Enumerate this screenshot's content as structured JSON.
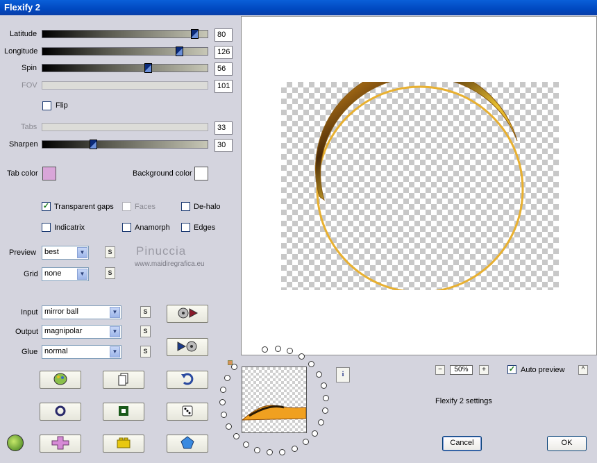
{
  "window": {
    "title": "Flexify 2"
  },
  "sliders": [
    {
      "label": "Latitude",
      "value": "80",
      "level": 0.94,
      "enabled": true
    },
    {
      "label": "Longitude",
      "value": "126",
      "level": 0.83,
      "enabled": true
    },
    {
      "label": "Spin",
      "value": "56",
      "level": 0.64,
      "enabled": true
    },
    {
      "label": "FOV",
      "value": "101",
      "enabled": false
    },
    {
      "label": "Tabs",
      "value": "33",
      "enabled": false
    },
    {
      "label": "Sharpen",
      "value": "30",
      "level": 0.31,
      "enabled": true
    }
  ],
  "flip": {
    "label": "Flip",
    "checked": false
  },
  "colors": {
    "tab_label": "Tab color",
    "tab_color": "#d9a6d9",
    "bg_label": "Background color",
    "bg_color": "#ffffff"
  },
  "options": {
    "transparent_gaps": {
      "label": "Transparent gaps",
      "checked": true
    },
    "faces": {
      "label": "Faces",
      "checked": false
    },
    "dehalo": {
      "label": "De-halo",
      "checked": false
    },
    "indicatrix": {
      "label": "Indicatrix",
      "checked": false
    },
    "anamorph": {
      "label": "Anamorph",
      "checked": false
    },
    "edges": {
      "label": "Edges",
      "checked": false
    }
  },
  "preview_select": {
    "label": "Preview",
    "value": "best"
  },
  "grid_select": {
    "label": "Grid",
    "value": "none"
  },
  "input_select": {
    "label": "Input",
    "value": "mirror ball"
  },
  "output_select": {
    "label": "Output",
    "value": "magnipolar"
  },
  "glue_select": {
    "label": "Glue",
    "value": "normal"
  },
  "s_label": "S",
  "watermark": {
    "name": "Pinuccia",
    "url": "www.maidiregrafica.eu"
  },
  "zoom": {
    "minus": "−",
    "value": "50%",
    "plus": "+"
  },
  "auto_preview": {
    "label": "Auto preview",
    "checked": true
  },
  "caret": "^",
  "status": "Flexify 2 settings",
  "cancel_label": "Cancel",
  "ok_label": "OK"
}
